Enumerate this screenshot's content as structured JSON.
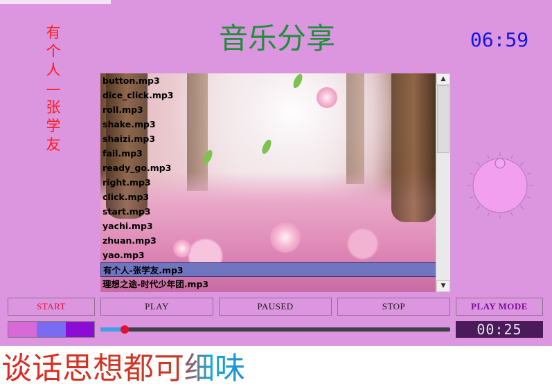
{
  "header": {
    "vertical_title": [
      "有",
      "个",
      "人",
      "—",
      "张",
      "学",
      "友"
    ],
    "main_title": "音乐分享",
    "clock": "06:59"
  },
  "playlist": {
    "songs": [
      "button.mp3",
      "dice_click.mp3",
      "roll.mp3",
      "shake.mp3",
      "shaizi.mp3",
      "fail.mp3",
      "ready_go.mp3",
      "right.mp3",
      "click.mp3",
      "start.mp3",
      "yachi.mp3",
      "zhuan.mp3",
      "yao.mp3",
      "有个人-张学友.mp3",
      "理想之途-时代少年团.mp3"
    ],
    "selected_index": 13
  },
  "controls": {
    "start_label": "START",
    "play_label": "PLAY",
    "paused_label": "PAUSED",
    "stop_label": "STOP",
    "play_mode_label": "PLAY MODE"
  },
  "swatches": [
    "#d86ad8",
    "#7a6cf0",
    "#8c0cd6"
  ],
  "progress": {
    "fraction": 0.07
  },
  "elapsed_time": "00:25",
  "footer_text": "谈话思想都可细味",
  "colors": {
    "app_background": "#dc95df",
    "selection": "#7075bf",
    "title_green": "#1f8f3a",
    "clock_blue": "#1515e0"
  }
}
